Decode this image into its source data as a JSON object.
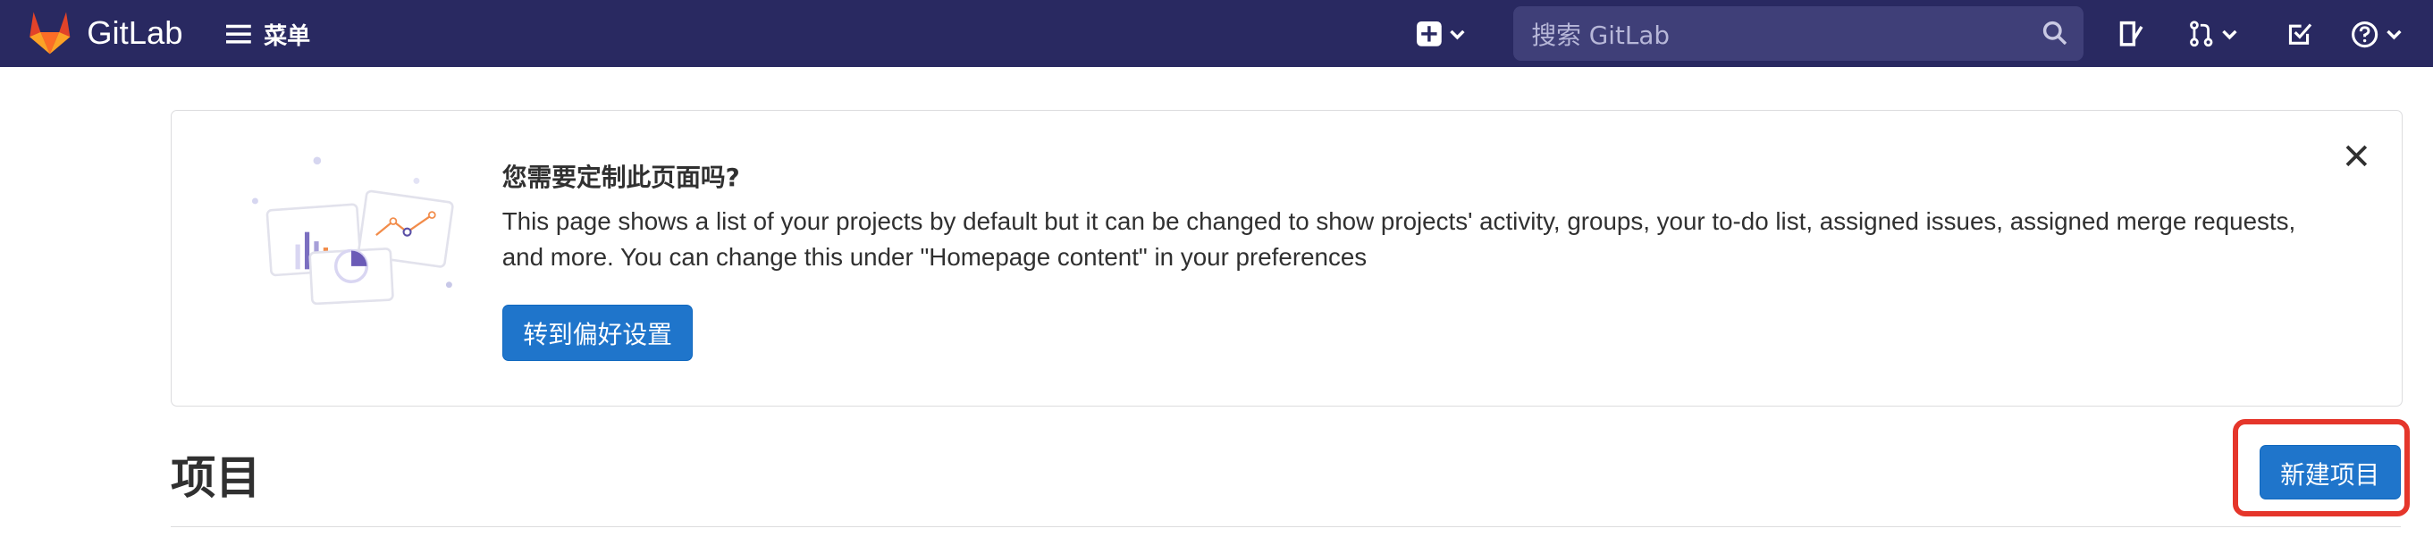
{
  "navbar": {
    "brand": "GitLab",
    "menu_label": "菜单",
    "search": {
      "placeholder": "搜索 GitLab"
    },
    "icons": [
      "plus-square-icon",
      "issues-icon",
      "merge-request-icon",
      "todo-icon",
      "help-icon"
    ]
  },
  "callout": {
    "title": "您需要定制此页面吗?",
    "body": "This page shows a list of your projects by default but it can be changed to show projects' activity, groups, your to-do list, assigned issues, assigned merge requests, and more. You can change this under \"Homepage content\" in your preferences",
    "button_label": "转到偏好设置"
  },
  "page": {
    "title": "项目",
    "new_project_label": "新建项目"
  },
  "colors": {
    "navbar_bg": "#292961",
    "search_bg": "#3f3f78",
    "primary_button": "#1f75cb",
    "highlight": "#e5362b"
  }
}
